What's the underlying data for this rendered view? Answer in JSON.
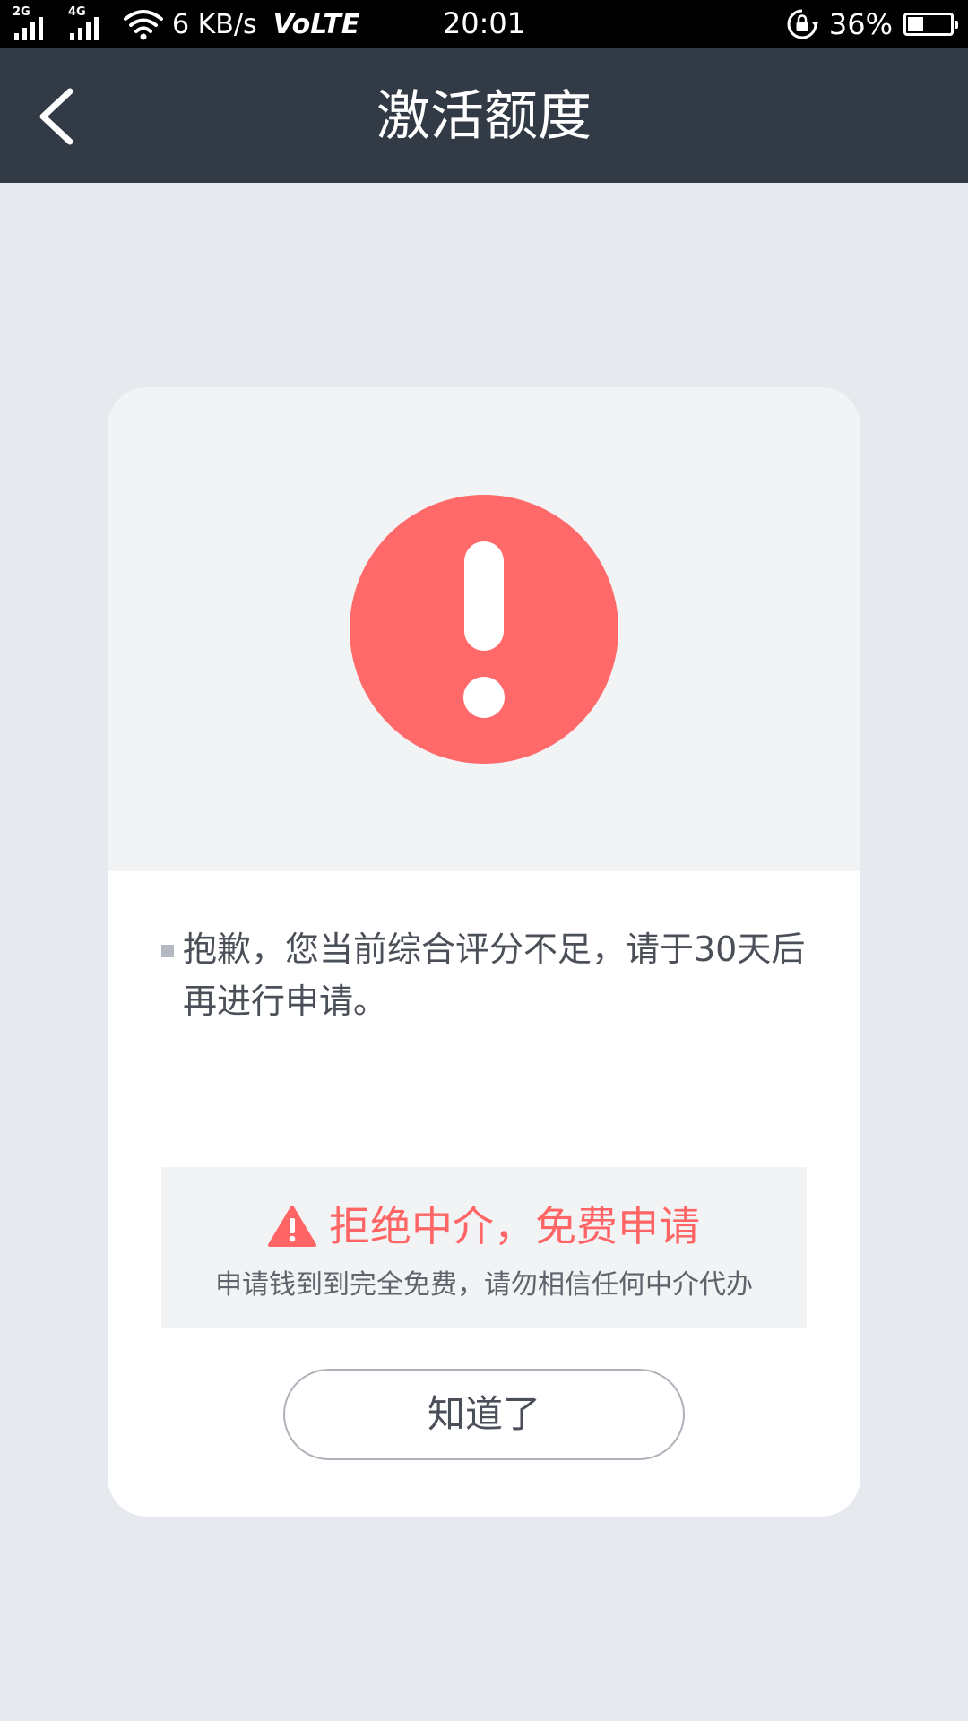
{
  "status_bar": {
    "network_1": "2G",
    "network_2": "4G",
    "speed": "6 KB/s",
    "volte": "VoLTE",
    "time": "20:01",
    "battery_percent": "36%",
    "battery_level": 0.36,
    "icons": [
      "signal-icon",
      "wifi-icon",
      "rotation-lock-icon",
      "battery-icon"
    ]
  },
  "nav": {
    "title": "激活额度",
    "back_icon": "chevron-left-icon"
  },
  "card": {
    "alert_icon": "exclamation-circle-icon",
    "message": "抱歉，您当前综合评分不足，请于30天后再进行申请。",
    "notice": {
      "icon": "warning-triangle-icon",
      "title": "拒绝中介，免费申请",
      "subtitle": "申请钱到到完全免费，请勿相信任何中介代办"
    },
    "button_label": "知道了"
  },
  "colors": {
    "status_bar_bg": "#000000",
    "nav_bg": "#323a45",
    "page_bg": "#e6e9ee",
    "card_bg": "#ffffff",
    "card_top_bg": "#f2f3f5",
    "alert_red": "#ff6969",
    "notice_red": "#ff6565",
    "text_dark": "#4a4f58"
  }
}
